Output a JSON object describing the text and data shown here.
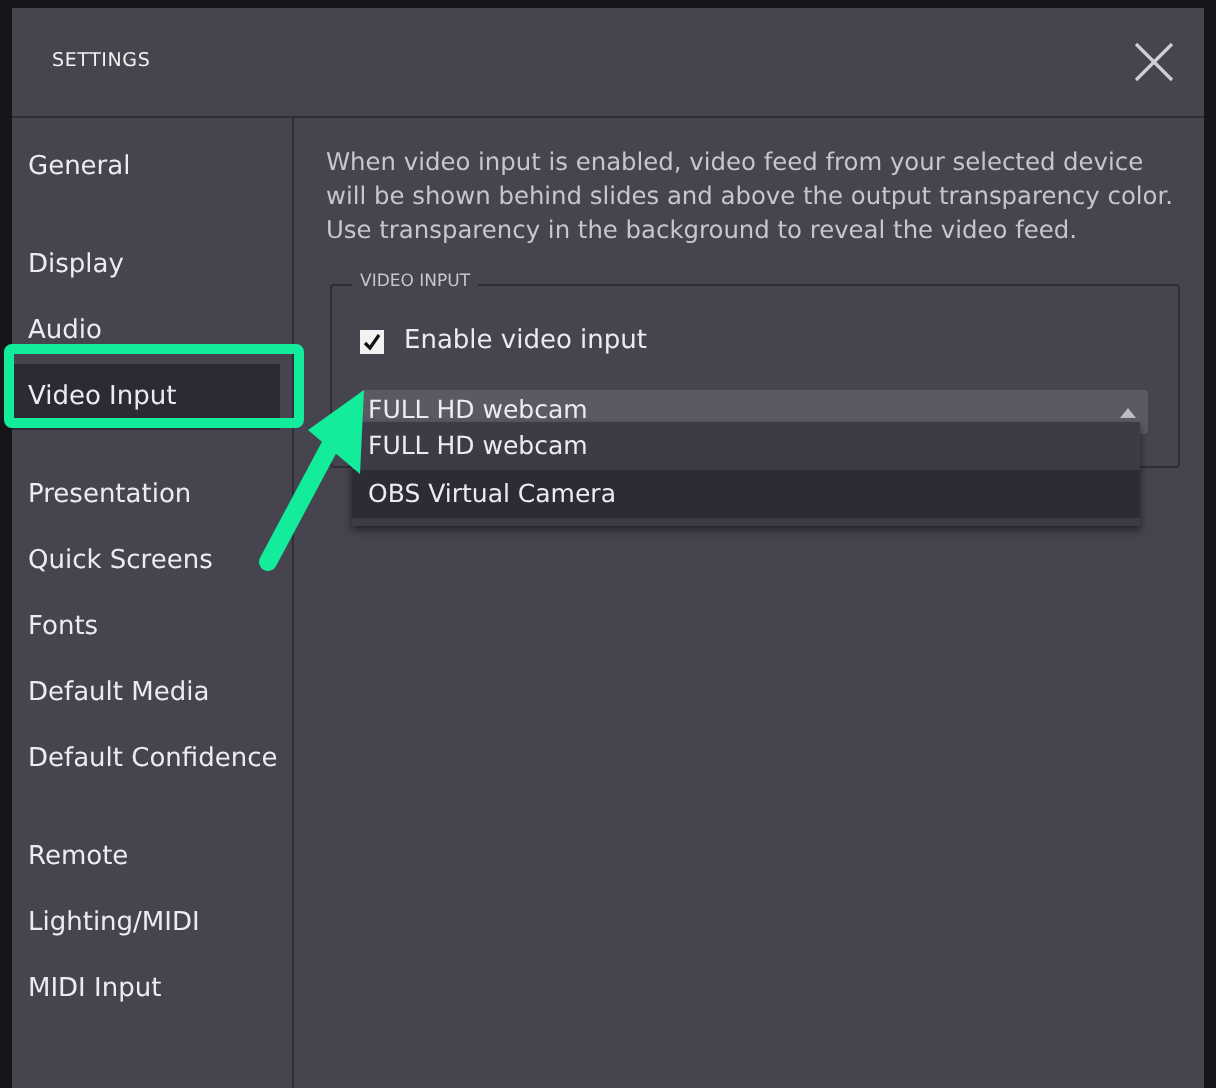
{
  "window": {
    "title": "SETTINGS"
  },
  "sidebar": {
    "groups": [
      [
        {
          "label": "General",
          "selected": false
        }
      ],
      [
        {
          "label": "Display",
          "selected": false
        },
        {
          "label": "Audio",
          "selected": false
        },
        {
          "label": "Video Input",
          "selected": true
        }
      ],
      [
        {
          "label": "Presentation",
          "selected": false
        },
        {
          "label": "Quick Screens",
          "selected": false
        },
        {
          "label": "Fonts",
          "selected": false
        },
        {
          "label": "Default Media",
          "selected": false
        },
        {
          "label": "Default Confidence",
          "selected": false
        }
      ],
      [
        {
          "label": "Remote",
          "selected": false
        },
        {
          "label": "Lighting/MIDI",
          "selected": false
        },
        {
          "label": "MIDI Input",
          "selected": false
        }
      ]
    ]
  },
  "description": "When video input is enabled, video feed from your selected device will be shown behind slides and above the output transparency color. Use transparency in the background to reveal the video feed.",
  "video_input": {
    "legend": "VIDEO INPUT",
    "enable": {
      "label": "Enable video input",
      "checked": true
    },
    "device_select": {
      "value": "FULL HD webcam",
      "expanded": true,
      "options": [
        {
          "label": "FULL HD webcam",
          "highlighted": false
        },
        {
          "label": "OBS Virtual Camera",
          "highlighted": true
        }
      ]
    }
  }
}
